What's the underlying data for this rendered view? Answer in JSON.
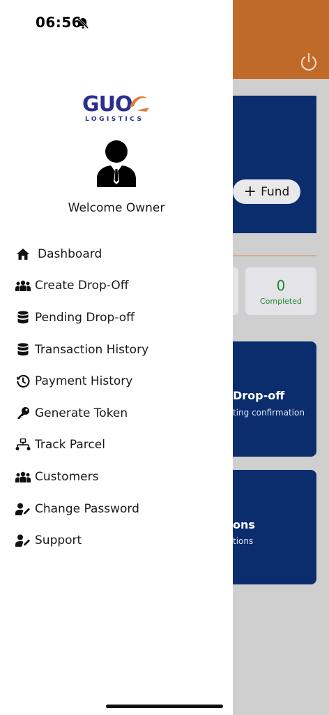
{
  "status_bar": {
    "time": "06:56",
    "silent_icon": "bell-slash-icon"
  },
  "logo": {
    "main": "GUO",
    "sub": "LOGISTICS",
    "colors": {
      "primary": "#2a2f8f",
      "accent": "#e07b39"
    }
  },
  "drawer": {
    "welcome": "Welcome Owner",
    "menu": [
      {
        "label": "Dashboard",
        "icon": "home-icon"
      },
      {
        "label": "Create Drop-Off",
        "icon": "users-icon"
      },
      {
        "label": "Pending Drop-off",
        "icon": "database-icon"
      },
      {
        "label": "Transaction History",
        "icon": "database-icon"
      },
      {
        "label": "Payment History",
        "icon": "history-icon"
      },
      {
        "label": "Generate Token",
        "icon": "key-icon"
      },
      {
        "label": "Track Parcel",
        "icon": "route-icon"
      },
      {
        "label": "Customers",
        "icon": "users-icon"
      },
      {
        "label": "Change Password",
        "icon": "user-edit-icon"
      },
      {
        "label": "Support",
        "icon": "user-edit-icon"
      }
    ]
  },
  "background": {
    "fund_label": "Fund",
    "stat": {
      "value": "0",
      "label": "Completed"
    },
    "card1": {
      "title": "Drop-off",
      "subtitle": "ting confirmation"
    },
    "card2": {
      "title": "ons",
      "subtitle": "tions"
    },
    "colors": {
      "header": "#c06a29",
      "card": "#0b2d6e",
      "stat_text": "#1e8a2b"
    }
  }
}
